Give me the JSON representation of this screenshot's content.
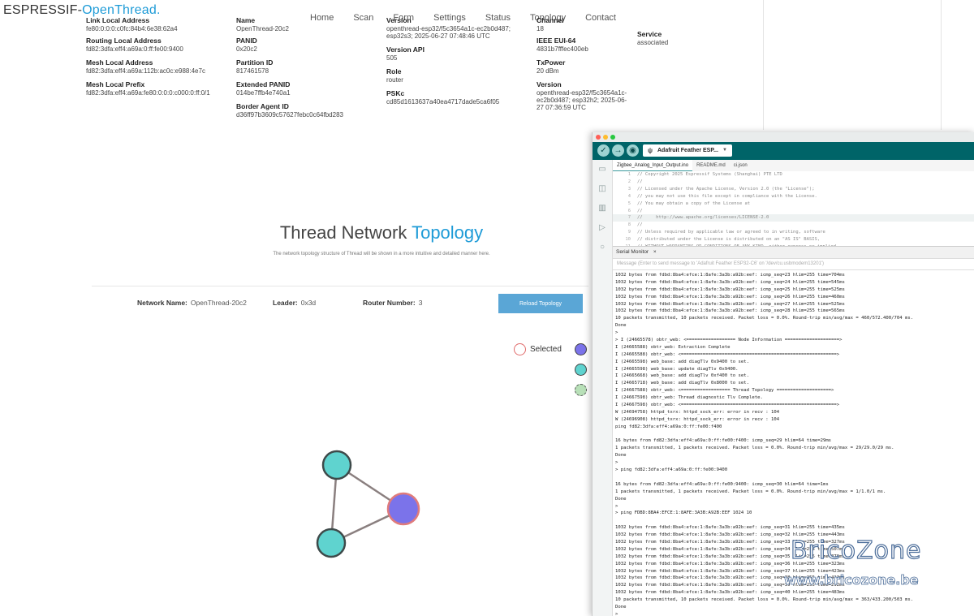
{
  "brand": {
    "part1": "ESPRESSIF-",
    "part2": "OpenThread."
  },
  "nav": [
    "Home",
    "Scan",
    "Form",
    "Settings",
    "Status",
    "Topology",
    "Contact"
  ],
  "status": {
    "col1": [
      {
        "key": "Link Local Address",
        "value": "fe80:0:0:0:c0fc:84b4:6e38:62a4"
      },
      {
        "key": "Routing Local Address",
        "value": "fd82:3dfa:eff4:a69a:0:ff:fe00:9400"
      },
      {
        "key": "Mesh Local Address",
        "value": "fd82:3dfa:eff4:a69a:112b:ac0c:e988:4e7c"
      },
      {
        "key": "Mesh Local Prefix",
        "value": "fd82:3dfa:eff4:a69a:fe80:0:0:0:c000:0:ff:0/1"
      }
    ],
    "col2": [
      {
        "key": "Name",
        "value": "OpenThread-20c2"
      },
      {
        "key": "PANID",
        "value": "0x20c2"
      },
      {
        "key": "Partition ID",
        "value": "817461578"
      },
      {
        "key": "Extended PANID",
        "value": "014be7ffb4e740a1"
      },
      {
        "key": "Border Agent ID",
        "value": "d36ff97b3609c57627febc0c64fbd283"
      }
    ],
    "col3": [
      {
        "key": "Version",
        "value": "openthread-esp32/f5c3654a1c-ec2b0d487; esp32s3; 2025-06-27 07:48:46 UTC"
      },
      {
        "key": "Version API",
        "value": "505"
      },
      {
        "key": "Role",
        "value": "router"
      },
      {
        "key": "PSKc",
        "value": "cd85d1613637a40ea4717dade5ca6f05"
      }
    ],
    "col4": [
      {
        "key": "Channel",
        "value": "18"
      },
      {
        "key": "IEEE EUI-64",
        "value": "4831b7fffec400eb"
      },
      {
        "key": "TxPower",
        "value": "20 dBm"
      },
      {
        "key": "Version",
        "value": "openthread-esp32/f5c3654a1c-ec2b0d487; esp32h2; 2025-06-27 07:36:59 UTC"
      }
    ],
    "col5": [
      {
        "key": "Service",
        "value": "associated"
      }
    ]
  },
  "topology": {
    "title_part1": "Thread Network",
    "title_part2": "Topology",
    "subtitle": "The network topology structure of Thread will be shown in a more intuitive and detailed manner here.",
    "network_name_label": "Network Name:",
    "network_name": "OpenThread-20c2",
    "leader_label": "Leader:",
    "leader": "0x3d",
    "router_number_label": "Router Number:",
    "router_number": "3",
    "reload_label": "Reload Topology",
    "legend_selected": "Selected",
    "colors": {
      "leader": "#7b73ea",
      "router": "#5fd3cf",
      "child": "#b8e0b8",
      "selected_border": "#e06b6b"
    }
  },
  "ide": {
    "board": "Adafruit Feather ESP...",
    "tabs": [
      "Zigbee_Analog_Input_Output.ino",
      "README.md",
      "ci.json"
    ],
    "code_lines": [
      {
        "n": "1",
        "t": "// Copyright 2025 Espressif Systems (Shanghai) PTE LTD"
      },
      {
        "n": "2",
        "t": "//"
      },
      {
        "n": "3",
        "t": "// Licensed under the Apache License, Version 2.0 (the \"License\");"
      },
      {
        "n": "4",
        "t": "// you may not use this file except in compliance with the License."
      },
      {
        "n": "5",
        "t": "// You may obtain a copy of the License at"
      },
      {
        "n": "6",
        "t": "//"
      },
      {
        "n": "7",
        "t": "//     http://www.apache.org/licenses/LICENSE-2.0"
      },
      {
        "n": "8",
        "t": "//"
      },
      {
        "n": "9",
        "t": "// Unless required by applicable law or agreed to in writing, software"
      },
      {
        "n": "10",
        "t": "// distributed under the License is distributed on an \"AS IS\" BASIS,"
      },
      {
        "n": "11",
        "t": "// WITHOUT WARRANTIES OR CONDITIONS OF ANY KIND, either express or implied."
      }
    ],
    "serial_title": "Serial Monitor",
    "serial_close": "×",
    "serial_placeholder": "Message (Enter to send message to 'Adafruit Feather ESP32-C6' on '/dev/cu.usbmodem13201')",
    "serial_lines": [
      "1032 bytes from fdbd:8ba4:efce:1:8afe:3a3b:a92b:eef: icmp_seq=23 hlim=255 time=704ms",
      "1032 bytes from fdbd:8ba4:efce:1:8afe:3a3b:a92b:eef: icmp_seq=24 hlim=255 time=545ms",
      "1032 bytes from fdbd:8ba4:efce:1:8afe:3a3b:a92b:eef: icmp_seq=25 hlim=255 time=525ms",
      "1032 bytes from fdbd:8ba4:efce:1:8afe:3a3b:a92b:eef: icmp_seq=26 hlim=255 time=460ms",
      "1032 bytes from fdbd:8ba4:efce:1:8afe:3a3b:a92b:eef: icmp_seq=27 hlim=255 time=525ms",
      "1032 bytes from fdbd:8ba4:efce:1:8afe:3a3b:a92b:eef: icmp_seq=28 hlim=255 time=565ms",
      "10 packets transmitted, 10 packets received. Packet loss = 0.0%. Round-trip min/avg/max = 460/572.400/704 ms.",
      "Done",
      ">",
      "> I (24665578) obtr_web: <================== Node Information ====================>",
      "I (24665588) obtr_web: Extraction Complete",
      "I (24665588) obtr_web: <=========================================================>",
      "I (24665598) web_base: add diagTlv 0x9400 to set.",
      "I (24665598) web_base: update diagTlv 0x9400.",
      "I (24665668) web_base: add diagTlv 0xf400 to set.",
      "I (24665718) web_base: add diagTlv 0x8000 to set.",
      "I (24667588) obtr_web: <================== Thread Topology ====================>",
      "I (24667598) obtr_web: Thread diagnostic Tlv Complete.",
      "I (24667598) obtr_web: <=========================================================>",
      "W (24694758) httpd_txrx: httpd_sock_err: error in recv : 104",
      "W (24696908) httpd_txrx: httpd_sock_err: error in recv : 104",
      "ping fd82:3dfa:eff4:a69a:0:ff:fe00:f400",
      "",
      "16 bytes from fd82:3dfa:eff4:a69a:0:ff:fe00:f400: icmp_seq=29 hlim=64 time=29ms",
      "1 packets transmitted, 1 packets received. Packet loss = 0.0%. Round-trip min/avg/max = 29/29.0/29 ms.",
      "Done",
      ">",
      "> ping fd82:3dfa:eff4:a69a:0:ff:fe00:9400",
      "",
      "16 bytes from fd82:3dfa:eff4:a69a:0:ff:fe00:9400: icmp_seq=30 hlim=64 time=1ms",
      "1 packets transmitted, 1 packets received. Packet loss = 0.0%. Round-trip min/avg/max = 1/1.0/1 ms.",
      "Done",
      ">",
      "> ping FDBD:8BA4:EFCE:1:8AFE:3A3B:A92B:EEF 1024 10",
      "",
      "1032 bytes from fdbd:8ba4:efce:1:8afe:3a3b:a92b:eef: icmp_seq=31 hlim=255 time=435ms",
      "1032 bytes from fdbd:8ba4:efce:1:8afe:3a3b:a92b:eef: icmp_seq=32 hlim=255 time=443ms",
      "1032 bytes from fdbd:8ba4:efce:1:8afe:3a3b:a92b:eef: icmp_seq=33 hlim=255 time=327ms",
      "1032 bytes from fdbd:8ba4:efce:1:8afe:3a3b:a92b:eef: icmp_seq=34 hlim=255 time=507ms",
      "1032 bytes from fdbd:8ba4:efce:1:8afe:3a3b:a92b:eef: icmp_seq=35 hlim=255 time=379ms",
      "1032 bytes from fdbd:8ba4:efce:1:8afe:3a3b:a92b:eef: icmp_seq=36 hlim=255 time=323ms",
      "1032 bytes from fdbd:8ba4:efce:1:8afe:3a3b:a92b:eef: icmp_seq=37 hlim=255 time=423ms",
      "1032 bytes from fdbd:8ba4:efce:1:8afe:3a3b:a92b:eef: icmp_seq=38 hlim=255 time=413ms",
      "1032 bytes from fdbd:8ba4:efce:1:8afe:3a3b:a92b:eef: icmp_seq=39 hlim=255 time=292ms",
      "1032 bytes from fdbd:8ba4:efce:1:8afe:3a3b:a92b:eef: icmp_seq=40 hlim=255 time=483ms",
      "10 packets transmitted, 10 packets received. Packet loss = 0.0%. Round-trip min/avg/max = 363/433.200/503 ms.",
      "Done",
      ">"
    ]
  },
  "watermark": {
    "line1": "BricoZone",
    "line2": "www.bricozone.be"
  }
}
